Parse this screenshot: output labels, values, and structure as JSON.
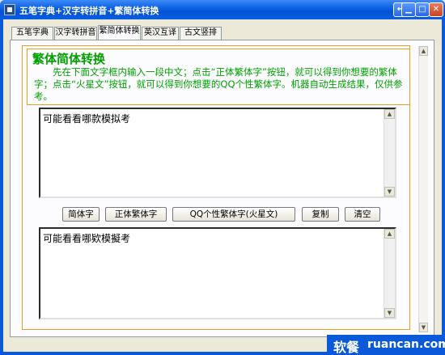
{
  "window": {
    "title": "五笔字典+汉字转拼音+繁简体转换",
    "restore_glyph": "↔",
    "min_glyph": "▁",
    "max_glyph": "□",
    "close_glyph": "✕"
  },
  "tabs": [
    {
      "label": "五笔字典",
      "active": false
    },
    {
      "label": "汉字转拼音",
      "active": false
    },
    {
      "label": "繁简体转换",
      "active": true
    },
    {
      "label": "英汉互译",
      "active": false
    },
    {
      "label": "古文竖排",
      "active": false
    }
  ],
  "main": {
    "heading": "繁体简体转换",
    "description": "先在下面文字框内输入一段中文；点击“正体繁体字”按钮，就可以得到你想要的繁体字；点击“火星文”按钮，就可以得到你想要的QQ个性繁体字。机器自动生成结果，仅供参考。"
  },
  "input_box": {
    "value": "可能看看哪款模拟考"
  },
  "output_box": {
    "value": "可能看看哪欵模擬考"
  },
  "buttons": {
    "simplified": "简体字",
    "traditional": "正体繁体字",
    "martian": "QQ个性繁体字(火星文)",
    "copy": "复制",
    "clear": "清空"
  },
  "scroll": {
    "up": "▲",
    "down": "▼"
  },
  "watermark": {
    "cn": "软餐",
    "en": "ruancan.com"
  },
  "colors": {
    "accent": "#00a000",
    "frame": "#e8a020",
    "titlebar": "#0a59d8"
  }
}
